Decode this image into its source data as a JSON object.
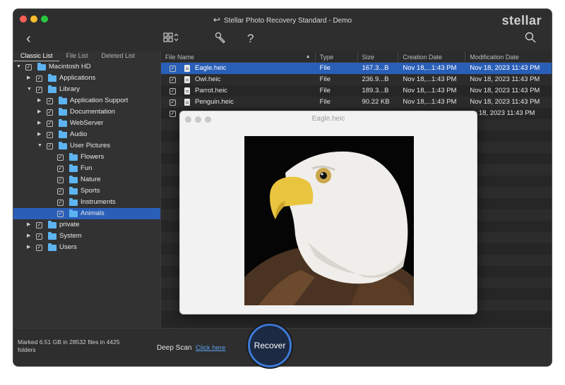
{
  "window": {
    "title": "Stellar Photo Recovery Standard - Demo",
    "brand": "stellar"
  },
  "toolbar": {
    "back_icon": "chevron-left-icon",
    "view_icon": "grid-view-icon",
    "tools_icon": "wrench-icon",
    "help_icon": "question-mark-icon",
    "search_icon": "search-icon"
  },
  "left_panel": {
    "tabs": [
      {
        "label": "Classic List",
        "active": true
      },
      {
        "label": "File List",
        "active": false
      },
      {
        "label": "Deleted List",
        "active": false
      }
    ],
    "tree": [
      {
        "label": "Macintosh HD",
        "level": 0,
        "expanded": true,
        "selected": false
      },
      {
        "label": "Applications",
        "level": 1,
        "expanded": false,
        "selected": false
      },
      {
        "label": "Library",
        "level": 1,
        "expanded": true,
        "selected": false
      },
      {
        "label": "Application Support",
        "level": 2,
        "expanded": false,
        "selected": false
      },
      {
        "label": "Documentation",
        "level": 2,
        "expanded": false,
        "selected": false
      },
      {
        "label": "WebServer",
        "level": 2,
        "expanded": false,
        "selected": false
      },
      {
        "label": "Audio",
        "level": 2,
        "expanded": false,
        "selected": false
      },
      {
        "label": "User Pictures",
        "level": 2,
        "expanded": true,
        "selected": false
      },
      {
        "label": "Flowers",
        "level": 3,
        "leaf": true,
        "selected": false
      },
      {
        "label": "Fun",
        "level": 3,
        "leaf": true,
        "selected": false
      },
      {
        "label": "Nature",
        "level": 3,
        "leaf": true,
        "selected": false
      },
      {
        "label": "Sports",
        "level": 3,
        "leaf": true,
        "selected": false
      },
      {
        "label": "Instruments",
        "level": 3,
        "leaf": true,
        "selected": false
      },
      {
        "label": "Animals",
        "level": 3,
        "leaf": true,
        "selected": true
      },
      {
        "label": "private",
        "level": 1,
        "expanded": false,
        "selected": false
      },
      {
        "label": "System",
        "level": 1,
        "expanded": false,
        "selected": false
      },
      {
        "label": "Users",
        "level": 1,
        "expanded": false,
        "selected": false
      }
    ]
  },
  "file_table": {
    "columns": [
      "File Name",
      "Type",
      "Size",
      "Creation Date",
      "Modification Date"
    ],
    "rows": [
      {
        "name": "Eagle.heic",
        "type": "File",
        "size": "167.3...B",
        "created": "Nov 18,...1:43 PM",
        "modified": "Nov 18, 2023 11:43 PM",
        "selected": true
      },
      {
        "name": "Owl.heic",
        "type": "File",
        "size": "236.9...B",
        "created": "Nov 18,...1:43 PM",
        "modified": "Nov 18, 2023 11:43 PM",
        "selected": false
      },
      {
        "name": "Parrot.heic",
        "type": "File",
        "size": "189.3...B",
        "created": "Nov 18,...1:43 PM",
        "modified": "Nov 18, 2023 11:43 PM",
        "selected": false
      },
      {
        "name": "Penguin.heic",
        "type": "File",
        "size": "90.22 KB",
        "created": "Nov 18,...1:43 PM",
        "modified": "Nov 18, 2023 11:43 PM",
        "selected": false
      },
      {
        "name": "",
        "type": "",
        "size": "",
        "created": "",
        "modified": "ov 18, 2023 11:43 PM",
        "selected": false
      }
    ]
  },
  "preview": {
    "title": "Eagle.heic"
  },
  "status": {
    "marked_text": "Marked 6.51 GB in 28532 files in 4425 folders",
    "deep_scan_label": "Deep Scan",
    "click_here_label": "Click here",
    "recover_label": "Recover"
  },
  "colors": {
    "selection": "#2a5fb8",
    "folder": "#5db4f0",
    "link": "#5aa0ef",
    "recover_ring": "#3d7ad8"
  }
}
